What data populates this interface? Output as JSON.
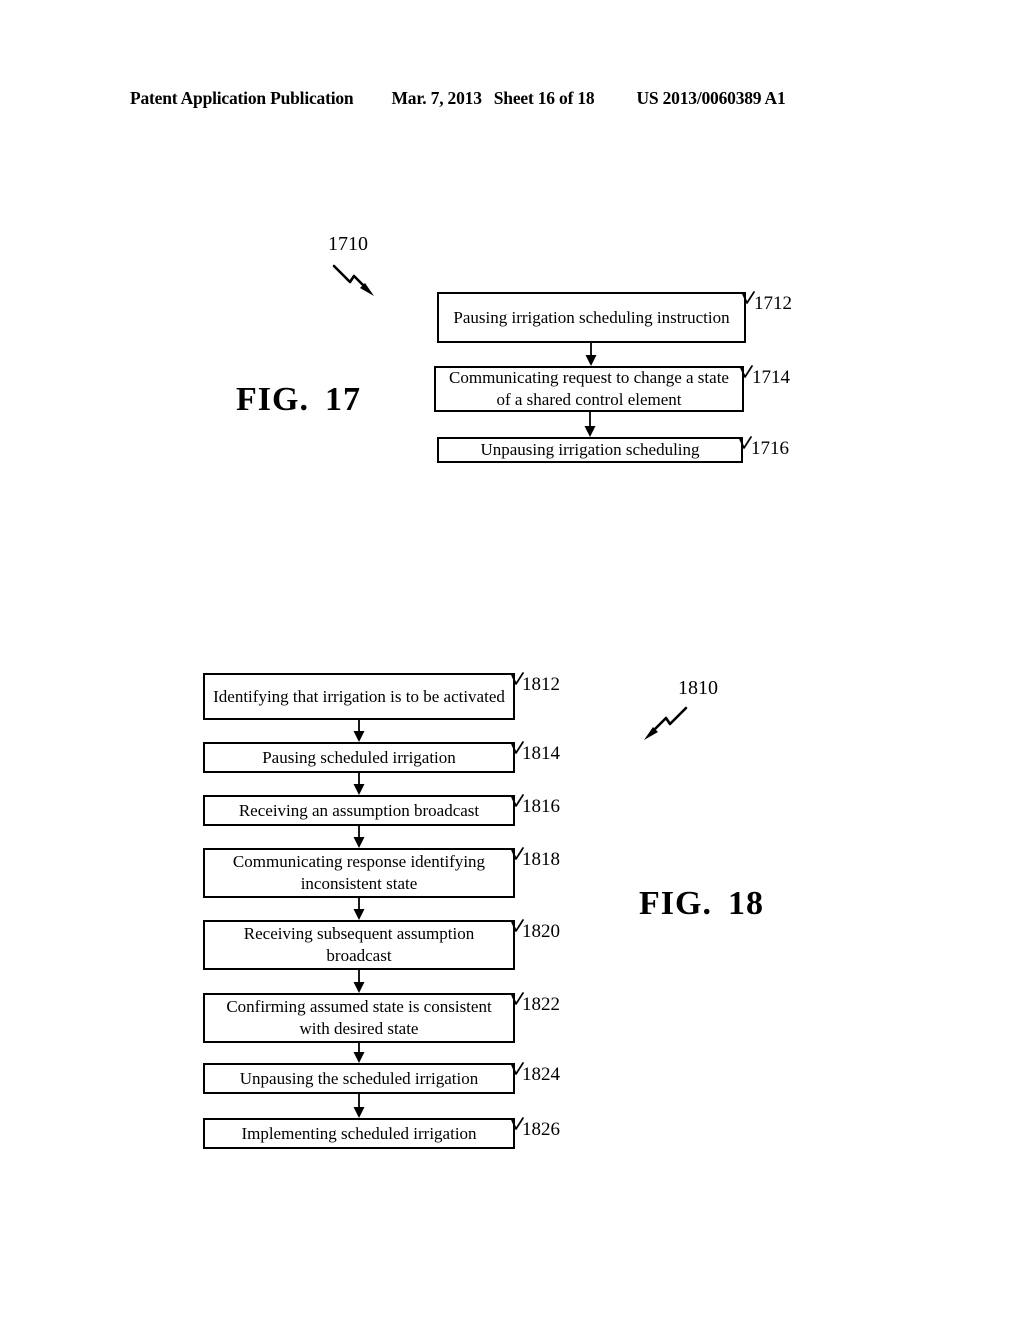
{
  "page": {
    "header": {
      "publication": "Patent Application Publication",
      "date": "Mar. 7, 2013",
      "sheet": "Sheet 16 of 18",
      "doc_number": "US 2013/0060389 A1"
    },
    "background_color": "#ffffff",
    "ink_color": "#000000"
  },
  "figures": [
    {
      "id": "fig17",
      "caption_word": "FIG.",
      "caption_number": "17",
      "group_label": "1710",
      "leader_icon": "zigzag-arrow-down-right-icon",
      "steps": [
        {
          "ref": "1712",
          "text": "Pausing irrigation scheduling instruction"
        },
        {
          "ref": "1714",
          "text": "Communicating request to change a state of a shared control element"
        },
        {
          "ref": "1716",
          "text": "Unpausing irrigation scheduling"
        }
      ]
    },
    {
      "id": "fig18",
      "caption_word": "FIG.",
      "caption_number": "18",
      "group_label": "1810",
      "leader_icon": "zigzag-arrow-down-left-icon",
      "steps": [
        {
          "ref": "1812",
          "text": "Identifying that irrigation is to be activated"
        },
        {
          "ref": "1814",
          "text": "Pausing scheduled irrigation"
        },
        {
          "ref": "1816",
          "text": "Receiving an assumption broadcast"
        },
        {
          "ref": "1818",
          "text": "Communicating response identifying inconsistent state"
        },
        {
          "ref": "1820",
          "text": "Receiving subsequent assumption broadcast"
        },
        {
          "ref": "1822",
          "text": "Confirming assumed state is consistent with desired state"
        },
        {
          "ref": "1824",
          "text": "Unpausing the scheduled irrigation"
        },
        {
          "ref": "1826",
          "text": "Implementing scheduled irrigation"
        }
      ]
    }
  ]
}
